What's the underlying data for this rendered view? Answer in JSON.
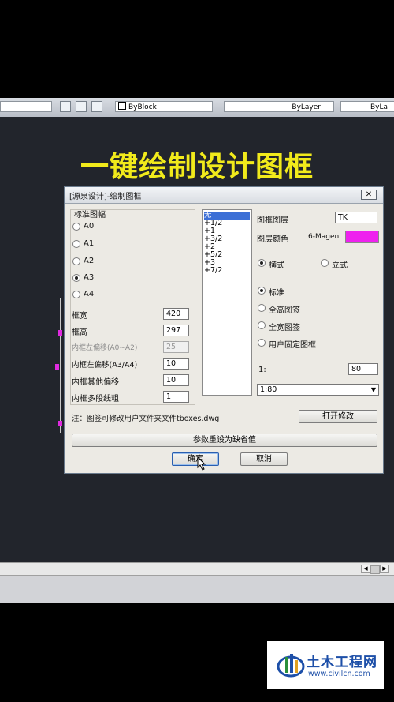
{
  "toolbar": {
    "color_field": "ByBlock",
    "linetype_field": "ByLayer",
    "lineweight_field": "ByLa"
  },
  "headline": "一键绘制设计图框",
  "dialog": {
    "title": "[源泉设计]-绘制图框",
    "close_icon": "✕",
    "paper_group_label": "标准图幅",
    "paper_sizes": [
      "A0",
      "A1",
      "A2",
      "A3",
      "A4"
    ],
    "paper_selected": "A3",
    "fields": [
      {
        "label": "框宽",
        "value": "420",
        "disabled": false
      },
      {
        "label": "框高",
        "value": "297",
        "disabled": false
      },
      {
        "label": "内框左偏移(A0~A2)",
        "value": "25",
        "disabled": true
      },
      {
        "label": "内框左偏移(A3/A4)",
        "value": "10",
        "disabled": false
      },
      {
        "label": "内框其他偏移",
        "value": "10",
        "disabled": false
      },
      {
        "label": "内框多段线粗",
        "value": "1",
        "disabled": false
      }
    ],
    "scale_list": [
      "无",
      "+1/2",
      "+1",
      "+3/2",
      "+2",
      "+5/2",
      "+3",
      "+7/2"
    ],
    "scale_list_selected": "无",
    "layer_label": "图框图层",
    "layer_value": "TK",
    "layer_color_label": "图层颜色",
    "layer_color_value": "6-Magen",
    "layer_color_hex": "#ee22ee",
    "orientation_options": [
      "横式",
      "立式"
    ],
    "orientation_selected": "横式",
    "signature_options": [
      "标准",
      "全高图签",
      "全宽图签",
      "用户固定图框"
    ],
    "signature_selected": "标准",
    "ratio_label": "1:",
    "ratio_value": "80",
    "ratio_combo": "1:80",
    "note": "注：图签可修改用户文件夹文件tboxes.dwg",
    "open_modify_button": "打开修改",
    "reset_button": "参数重设为缺省值",
    "ok_button": "确定",
    "cancel_button": "取消"
  },
  "watermark": {
    "name": "土木工程网",
    "url": "www.civilcn.com",
    "brand_color": "#1d4fa8"
  }
}
